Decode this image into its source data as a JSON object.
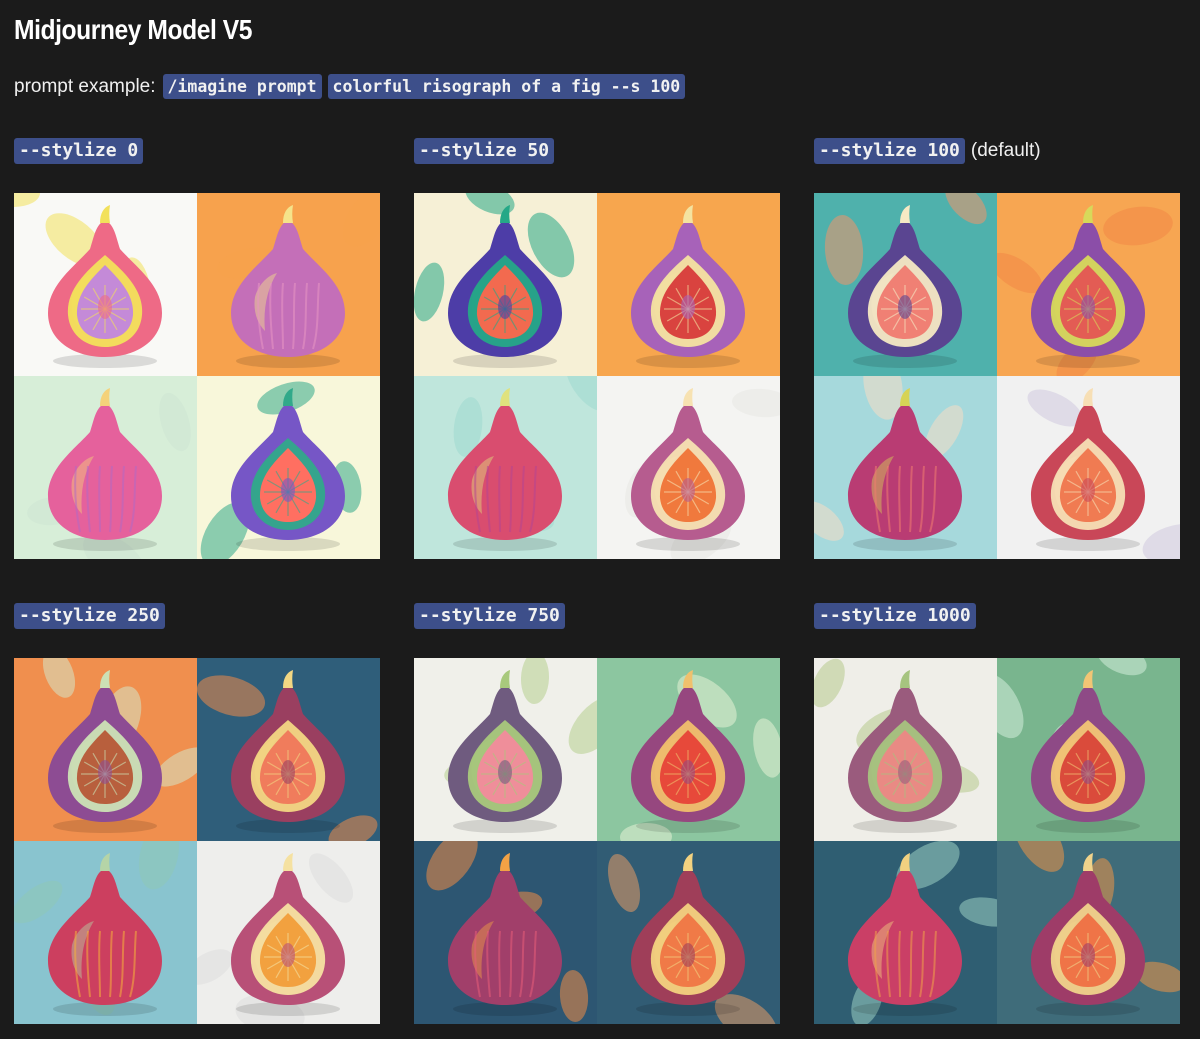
{
  "header": {
    "title": "Midjourney Model V5"
  },
  "prompt": {
    "label": "prompt example:",
    "command": "/imagine prompt",
    "text": "colorful risograph of a fig --s 100"
  },
  "sections": [
    {
      "param": "--stylize 0",
      "note": "",
      "tiles": [
        {
          "bg": "#f9f9f6",
          "fig": "#ee6a86",
          "flesh": "#c48ad8",
          "accent": "#f2e15b",
          "leaf": "#f2e15b",
          "kind": "half"
        },
        {
          "bg": "#f7a24d",
          "fig": "#c46fb8",
          "flesh": "#e895c3",
          "accent": "#f5e38a",
          "leaf": "#f7a24d",
          "kind": "whole"
        },
        {
          "bg": "#d7eed8",
          "fig": "#e5619c",
          "flesh": "#b36ac4",
          "accent": "#f4d27a",
          "leaf": "#cde6d4",
          "kind": "whole"
        },
        {
          "bg": "#f8f7da",
          "fig": "#7656c6",
          "flesh": "#ff6f61",
          "accent": "#31a98a",
          "leaf": "#31a98a",
          "kind": "half"
        }
      ]
    },
    {
      "param": "--stylize 50",
      "note": "",
      "tiles": [
        {
          "bg": "#f6f0d6",
          "fig": "#4d3da7",
          "flesh": "#f26a4f",
          "accent": "#25a887",
          "leaf": "#25a887",
          "kind": "half"
        },
        {
          "bg": "#f7a64e",
          "fig": "#a762b9",
          "flesh": "#d9433f",
          "accent": "#f4e3a0",
          "leaf": "#f7a64e",
          "kind": "half"
        },
        {
          "bg": "#bfe6dc",
          "fig": "#d94d6f",
          "flesh": "#b44591",
          "accent": "#dfe27d",
          "leaf": "#9fd8cf",
          "kind": "whole"
        },
        {
          "bg": "#f4f4f2",
          "fig": "#b65c8f",
          "flesh": "#f0793d",
          "accent": "#f7e2b2",
          "leaf": "#e8e8e4",
          "kind": "half"
        }
      ]
    },
    {
      "param": "--stylize 100",
      "note": "(default)",
      "tiles": [
        {
          "bg": "#4fb1ac",
          "fig": "#5a4591",
          "flesh": "#f08074",
          "accent": "#f6e9c4",
          "leaf": "#f3946a",
          "kind": "half"
        },
        {
          "bg": "#f7a652",
          "fig": "#8b4ea8",
          "flesh": "#e35c54",
          "accent": "#d7d95a",
          "leaf": "#f28746",
          "kind": "half"
        },
        {
          "bg": "#a6d9dc",
          "fig": "#b93c73",
          "flesh": "#f07c70",
          "accent": "#d6d356",
          "leaf": "#f6dcc5",
          "kind": "whole"
        },
        {
          "bg": "#f1f1f1",
          "fig": "#c94758",
          "flesh": "#f07b52",
          "accent": "#f7dfb5",
          "leaf": "#cfc8df",
          "kind": "half"
        }
      ]
    },
    {
      "param": "--stylize 250",
      "note": "",
      "tiles": [
        {
          "bg": "#f08f4e",
          "fig": "#8d4c93",
          "flesh": "#b85f3d",
          "accent": "#cce1b5",
          "leaf": "#d5e6c6",
          "kind": "half"
        },
        {
          "bg": "#2f5e7a",
          "fig": "#9a3f60",
          "flesh": "#f07c5c",
          "accent": "#f3d783",
          "leaf": "#ef8a48",
          "kind": "half"
        },
        {
          "bg": "#89c4cf",
          "fig": "#cc3f5f",
          "flesh": "#f5b03b",
          "accent": "#b5d4a7",
          "leaf": "#8ec9b6",
          "kind": "whole"
        },
        {
          "bg": "#eeeeec",
          "fig": "#b85077",
          "flesh": "#f2a13f",
          "accent": "#f5e1a1",
          "leaf": "#dedede",
          "kind": "half"
        }
      ]
    },
    {
      "param": "--stylize 750",
      "note": "",
      "tiles": [
        {
          "bg": "#f0f0ea",
          "fig": "#6f5b7f",
          "flesh": "#ef8e9a",
          "accent": "#a8c97c",
          "leaf": "#b7cf8e",
          "kind": "half"
        },
        {
          "bg": "#8cc6a0",
          "fig": "#96477f",
          "flesh": "#e7493a",
          "accent": "#f0c06d",
          "leaf": "#e6f2d6",
          "kind": "half"
        },
        {
          "bg": "#2d5672",
          "fig": "#a13f6a",
          "flesh": "#e85c78",
          "accent": "#f2a245",
          "leaf": "#ee8c45",
          "kind": "whole"
        },
        {
          "bg": "#315c74",
          "fig": "#9f3e59",
          "flesh": "#f07a47",
          "accent": "#f3d280",
          "leaf": "#e49a64",
          "kind": "half"
        }
      ]
    },
    {
      "param": "--stylize 1000",
      "note": "",
      "tiles": [
        {
          "bg": "#efeee8",
          "fig": "#9a5b7d",
          "flesh": "#e98a84",
          "accent": "#a6c47f",
          "leaf": "#b7cb8c",
          "kind": "half"
        },
        {
          "bg": "#79b58e",
          "fig": "#8e4a86",
          "flesh": "#da4b3b",
          "accent": "#f2c575",
          "leaf": "#d3ecda",
          "kind": "half"
        },
        {
          "bg": "#2f5e72",
          "fig": "#ca3f66",
          "flesh": "#f0a048",
          "accent": "#f1d180",
          "leaf": "#9ad0c2",
          "kind": "whole"
        },
        {
          "bg": "#3f6c7a",
          "fig": "#9e3c68",
          "flesh": "#ef7447",
          "accent": "#f0d38b",
          "leaf": "#ef9645",
          "kind": "half"
        }
      ]
    }
  ]
}
